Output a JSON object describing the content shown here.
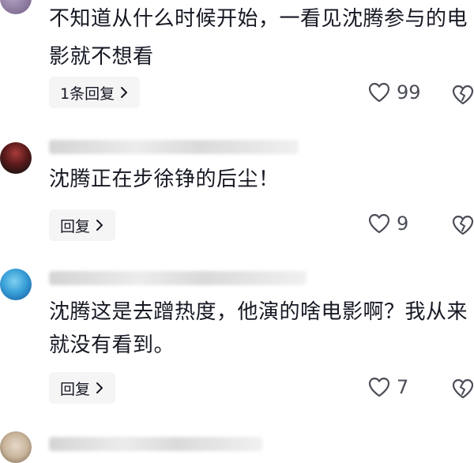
{
  "comments": [
    {
      "text": "不知道从什么时候开始，一看见沈腾参与的电影就不想看",
      "reply_label": "1条回复",
      "likes": "99"
    },
    {
      "text": "沈腾正在步徐铮的后尘！",
      "reply_label": "回复",
      "likes": "9"
    },
    {
      "text": "沈腾这是去蹭热度，他演的啥电影啊？我从来就没有看到。",
      "reply_label": "回复",
      "likes": "7"
    }
  ],
  "icons": {
    "like": "heart-outline-icon",
    "dislike": "broken-heart-outline-icon",
    "chevron": "chevron-right-icon"
  },
  "colors": {
    "text": "#161823",
    "secondary_text": "#4b4d57",
    "reply_bg": "#f5f5f6"
  }
}
